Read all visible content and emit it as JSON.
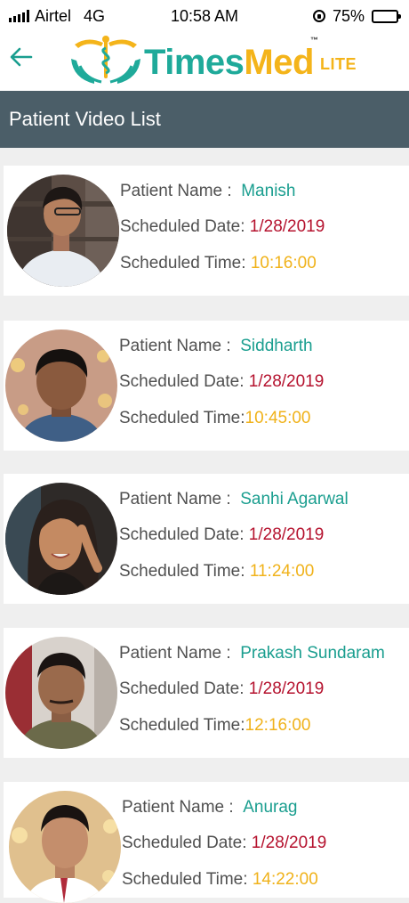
{
  "status_bar": {
    "carrier": "Airtel",
    "network": "4G",
    "time": "10:58 AM",
    "battery": "75%",
    "battery_level": 0.75
  },
  "header": {
    "logo_part1": "Times",
    "logo_part2": "Med",
    "logo_tm": "™",
    "logo_suffix": "LITE"
  },
  "page_title": "Patient Video List",
  "labels": {
    "patient_name": "Patient Name :",
    "scheduled_date": "Scheduled Date:",
    "scheduled_time": "Scheduled Time:"
  },
  "patients": [
    {
      "name": "Manish",
      "date": "1/28/2019",
      "time": "10:16:00"
    },
    {
      "name": "Siddharth",
      "date": "1/28/2019",
      "time": "10:45:00"
    },
    {
      "name": "Sanhi Agarwal",
      "date": "1/28/2019",
      "time": "11:24:00"
    },
    {
      "name": "Prakash Sundaram",
      "date": "1/28/2019",
      "time": "12:16:00"
    },
    {
      "name": "Anurag",
      "date": "1/28/2019",
      "time": "14:22:00"
    }
  ],
  "colors": {
    "header_bar": "#4b5e68",
    "brand_teal": "#1faa9a",
    "brand_gold": "#f4b41a",
    "date_red": "#b5122e"
  }
}
